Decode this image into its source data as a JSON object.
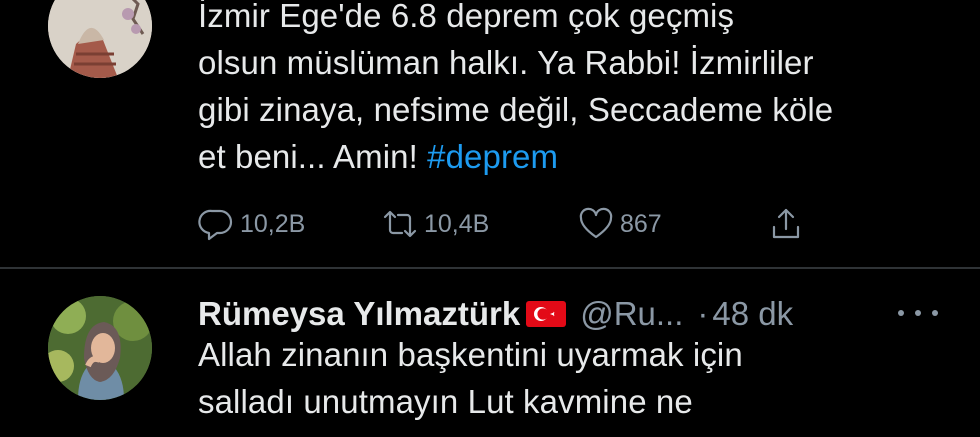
{
  "colors": {
    "background": "#000000",
    "text": "#e7e9ea",
    "muted": "#8b98a5",
    "hashtag": "#1d9bf0",
    "divider": "#2f3336"
  },
  "tweets": [
    {
      "text_lines": [
        "İzmir Ege'de 6.8  deprem çok geçmiş",
        "olsun müslüman halkı. Ya Rabbi! İzmirliler",
        "gibi zinaya, nefsime değil, Seccademe köle"
      ],
      "last_line_text": "et beni... Amin! ",
      "hashtag": "#deprem",
      "actions": {
        "reply": {
          "icon": "reply-icon",
          "count": "10,2B"
        },
        "retweet": {
          "icon": "retweet-icon",
          "count": "10,4B"
        },
        "like": {
          "icon": "heart-icon",
          "count": "867"
        },
        "share": {
          "icon": "share-icon"
        }
      }
    },
    {
      "display_name": "Rümeysa Yılmaztürk",
      "flag": "turkey-flag-icon",
      "handle": "@Ru...",
      "separator": "·",
      "time": "48 dk",
      "more_icon": "more-options-icon",
      "text_lines": [
        "Allah zinanın başkentini uyarmak için",
        "salladı unutmayın Lut kavmine ne"
      ]
    }
  ]
}
